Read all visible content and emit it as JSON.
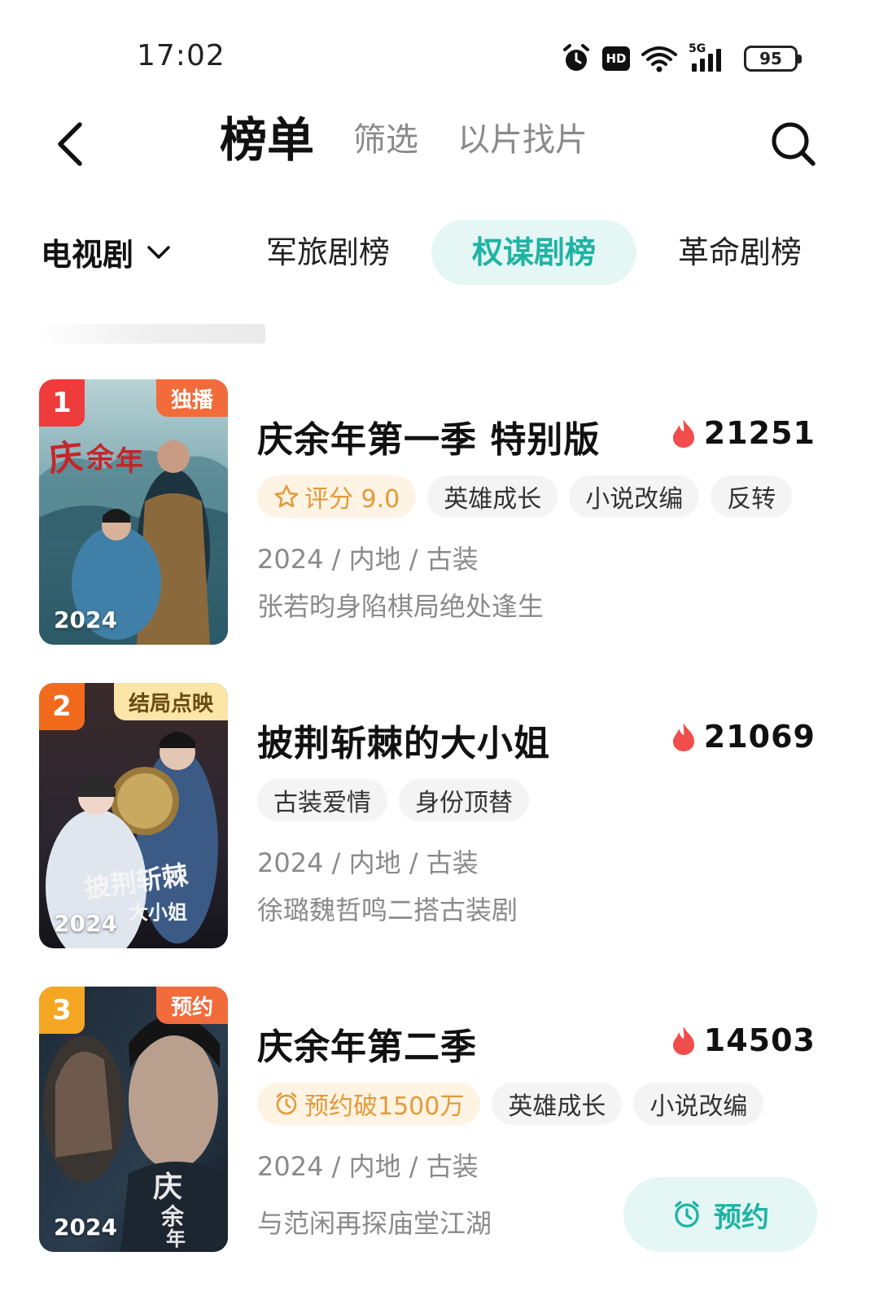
{
  "status_bar": {
    "time": "17:02",
    "icons": [
      "alarm-icon",
      "hd-icon",
      "wifi-icon",
      "5g-signal-icon",
      "battery-icon"
    ],
    "hd_label": "HD",
    "network_label": "5G",
    "battery": "95"
  },
  "header": {
    "tabs": [
      {
        "label": "榜单",
        "active": true
      },
      {
        "label": "筛选",
        "active": false
      },
      {
        "label": "以片找片",
        "active": false
      }
    ]
  },
  "category": {
    "selected": "电视剧",
    "tabs": [
      {
        "label": "军旅剧榜",
        "active": false
      },
      {
        "label": "权谋剧榜",
        "active": true
      },
      {
        "label": "革命剧榜",
        "active": false
      }
    ]
  },
  "colors": {
    "accent": "#1fb3a3",
    "accent_bg": "#e4f7f5",
    "heat": "#f24c4c",
    "rank1": "#ef3b3b",
    "rank2": "#f26b1d",
    "rank3": "#f5a623"
  },
  "items": [
    {
      "rank": "1",
      "badge": "独播",
      "poster_year": "2024",
      "title": "庆余年第一季 特别版",
      "heat": "21251",
      "tags": [
        {
          "label": "评分 9.0",
          "style": "rating",
          "icon": "star-icon"
        },
        {
          "label": "英雄成长"
        },
        {
          "label": "小说改编"
        },
        {
          "label": "反转"
        }
      ],
      "meta": "2024 / 内地 / 古装",
      "desc": "张若昀身陷棋局绝处逢生"
    },
    {
      "rank": "2",
      "badge": "结局点映",
      "poster_year": "2024",
      "title": "披荆斩棘的大小姐",
      "heat": "21069",
      "tags": [
        {
          "label": "古装爱情"
        },
        {
          "label": "身份顶替"
        }
      ],
      "meta": "2024 / 内地 / 古装",
      "desc": "徐璐魏哲鸣二搭古装剧"
    },
    {
      "rank": "3",
      "badge": "预约",
      "poster_year": "2024",
      "title": "庆余年第二季",
      "heat": "14503",
      "tags": [
        {
          "label": "预约破1500万",
          "style": "reserve",
          "icon": "clock-icon"
        },
        {
          "label": "英雄成长"
        },
        {
          "label": "小说改编"
        }
      ],
      "meta": "2024 / 内地 / 古装",
      "desc": "与范闲再探庙堂江湖",
      "action": "预约"
    }
  ]
}
